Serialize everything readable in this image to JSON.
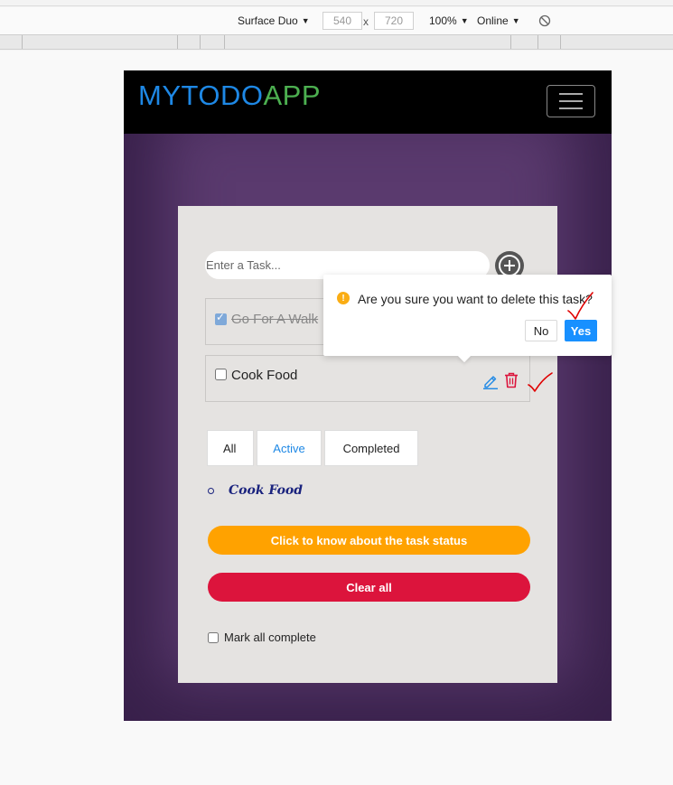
{
  "devtools": {
    "device": "Surface Duo",
    "width": "540",
    "height": "720",
    "times": "x",
    "zoom": "100%",
    "network": "Online"
  },
  "app": {
    "brand_part1": "MYTODO",
    "brand_part2": "APP",
    "input_placeholder": "Enter a Task...",
    "tasks": [
      {
        "label": "Go For A Walk",
        "completed": true
      },
      {
        "label": "Cook Food",
        "completed": false
      }
    ],
    "filters": {
      "all": "All",
      "active": "Active",
      "completed": "Completed"
    },
    "filtered_items": [
      "Cook Food"
    ],
    "status_button": "Click to know about the task status",
    "clear_button": "Clear all",
    "mark_all": "Mark all complete"
  },
  "popconfirm": {
    "title": "Are you sure you want to delete this task?",
    "no": "No",
    "yes": "Yes"
  },
  "colors": {
    "brand_blue": "#1e88e5",
    "brand_green": "#4caf50",
    "status_orange": "#ffa200",
    "clear_red": "#dc143c",
    "confirm_blue": "#1890ff",
    "annotation_red": "#e00000"
  },
  "icons": [
    "hamburger-icon",
    "plus-circle-icon",
    "edit-icon",
    "trash-icon",
    "warning-icon",
    "rotate-icon",
    "checkmark-annotation"
  ]
}
